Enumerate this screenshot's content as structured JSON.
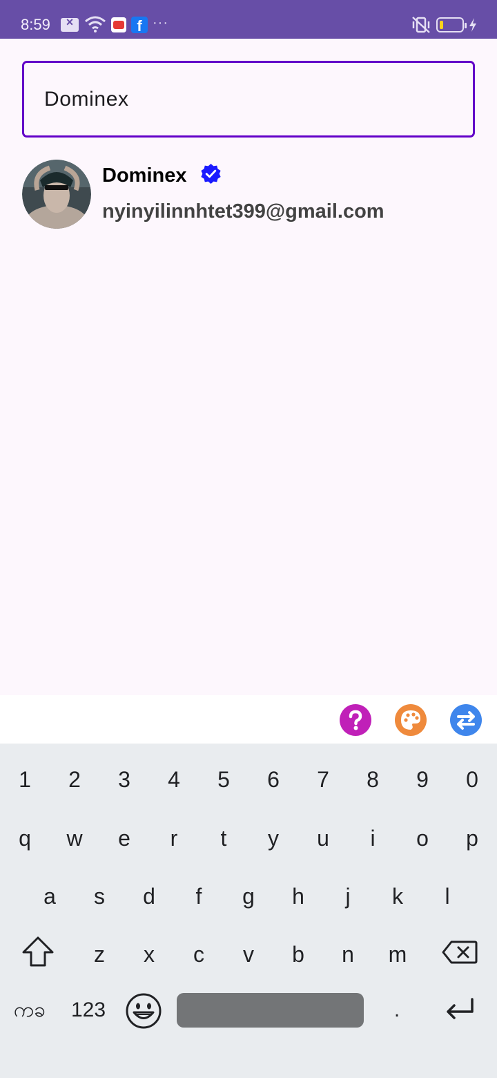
{
  "status_bar": {
    "time": "8:59",
    "icons": [
      "screenshot-icon",
      "wifi-icon",
      "youtube-icon",
      "facebook-icon",
      "more-icon",
      "vibrate-off-icon",
      "battery-icon",
      "charging-icon"
    ],
    "facebook_glyph": "f",
    "more_glyph": "···",
    "battery_level": 0.15,
    "colors": {
      "background": "#674ea7",
      "battery_fill": "#f8d21b"
    }
  },
  "search": {
    "value": "Dominex",
    "border_color": "#6200c8"
  },
  "results": [
    {
      "name": "Dominex",
      "email": "nyinyilinnhtet399@gmail.com",
      "verified": true,
      "verified_color": "#1a1aff"
    }
  ],
  "keyboard_toolbar": {
    "buttons": [
      {
        "icon": "help-icon",
        "color": "#c020b8"
      },
      {
        "icon": "palette-icon",
        "color": "#ef8a3c"
      },
      {
        "icon": "swap-icon",
        "color": "#3f86ec"
      }
    ]
  },
  "keyboard": {
    "number_row": [
      "1",
      "2",
      "3",
      "4",
      "5",
      "6",
      "7",
      "8",
      "9",
      "0"
    ],
    "row1": [
      "q",
      "w",
      "e",
      "r",
      "t",
      "y",
      "u",
      "i",
      "o",
      "p"
    ],
    "row2": [
      "a",
      "s",
      "d",
      "f",
      "g",
      "h",
      "j",
      "k",
      "l"
    ],
    "row3": [
      "z",
      "x",
      "c",
      "v",
      "b",
      "n",
      "m"
    ],
    "lang_label": "ကခ",
    "numbers_label": "123",
    "period_label": "."
  }
}
